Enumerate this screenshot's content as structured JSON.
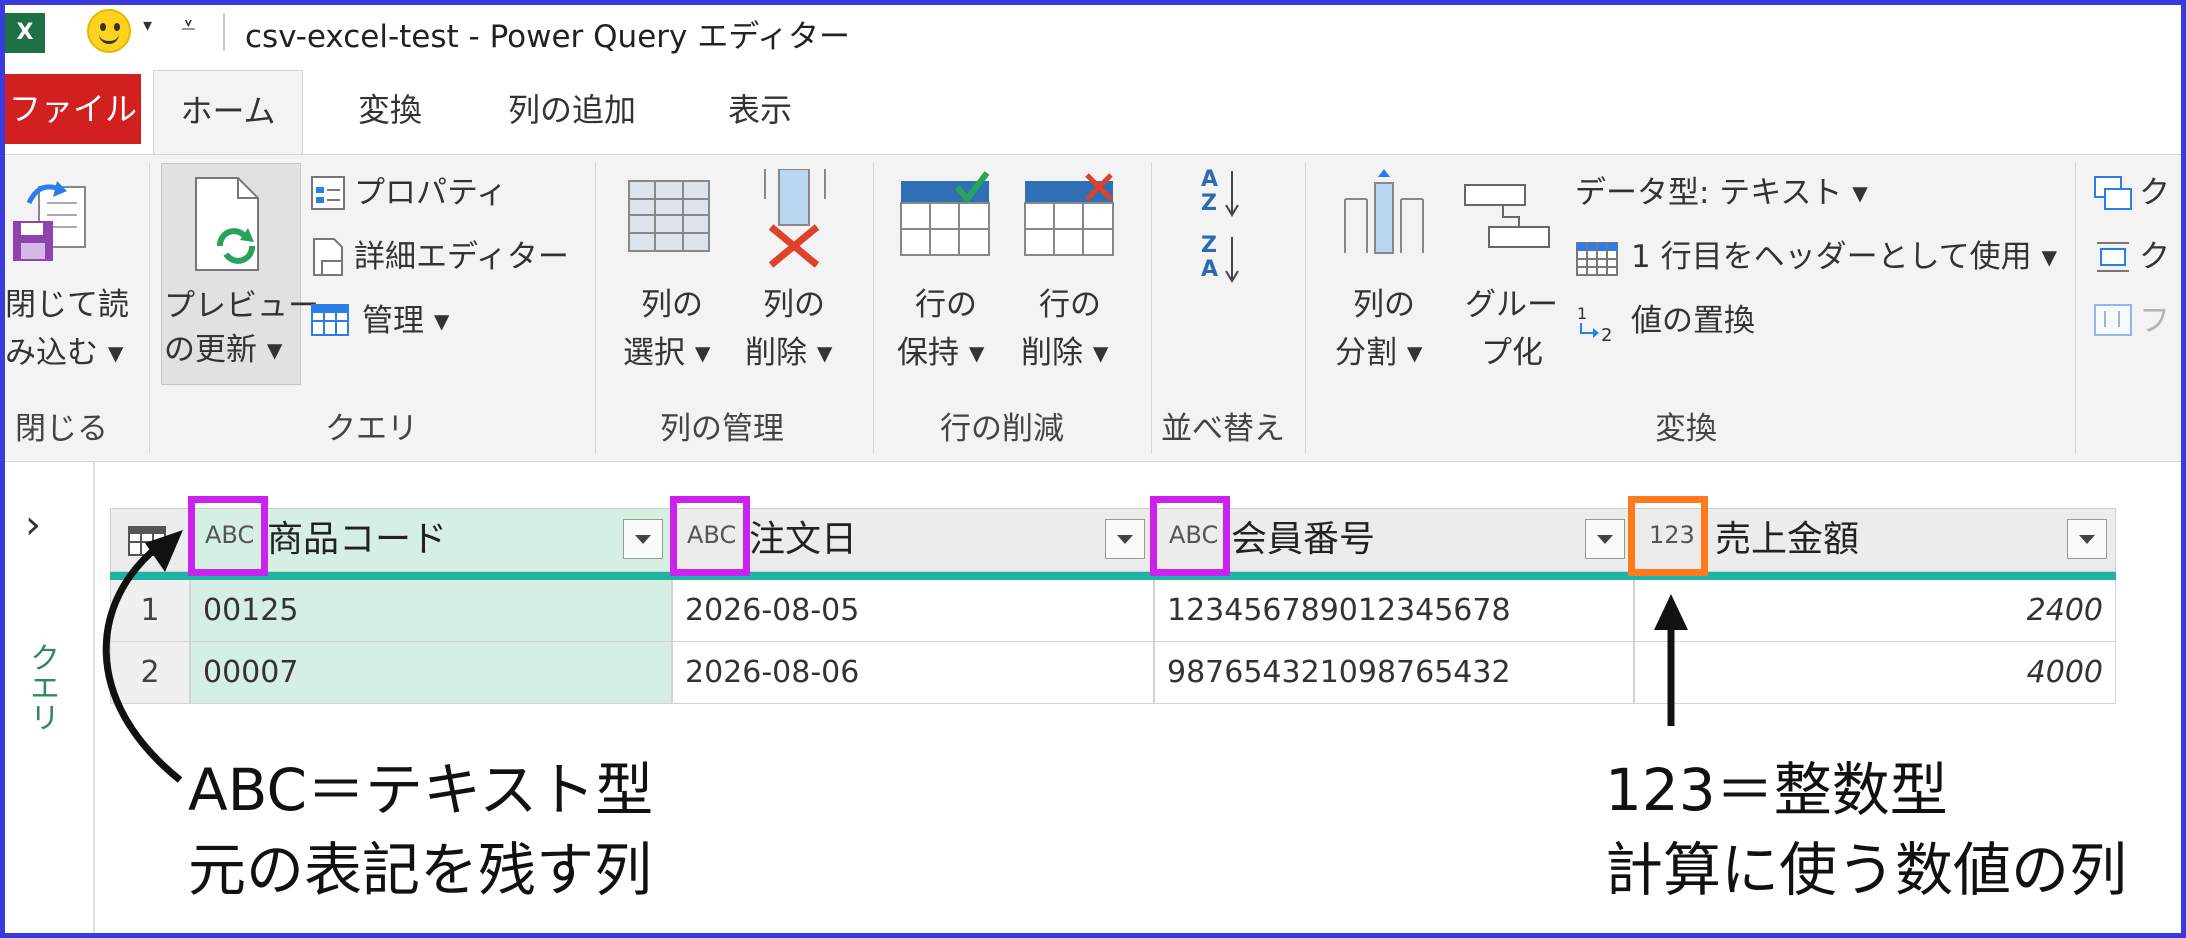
{
  "titlebar": {
    "excel_logo": "X",
    "window_title": "csv-excel-test - Power Query エディター",
    "qa_dropdown": "▾",
    "qa_customize": "⩡"
  },
  "tabs": [
    {
      "label": "ファイル"
    },
    {
      "label": "ホーム"
    },
    {
      "label": "変換"
    },
    {
      "label": "列の追加"
    },
    {
      "label": "表示"
    }
  ],
  "ribbon": {
    "close_load": {
      "line1": "閉じて読",
      "line2": "み込む ▾",
      "group": "閉じる"
    },
    "query": {
      "refresh_line1": "プレビュー",
      "refresh_line2": "の更新 ▾",
      "properties": "プロパティ",
      "advanced_editor": "詳細エディター",
      "manage": "管理 ▾",
      "group": "クエリ"
    },
    "manage_columns": {
      "choose_line1": "列の",
      "choose_line2": "選択 ▾",
      "remove_line1": "列の",
      "remove_line2": "削除 ▾",
      "group": "列の管理"
    },
    "reduce_rows": {
      "keep_line1": "行の",
      "keep_line2": "保持 ▾",
      "remove_line1": "行の",
      "remove_line2": "削除 ▾",
      "group": "行の削減"
    },
    "sort": {
      "asc_top": "A",
      "asc_bottom": "Z",
      "desc_top": "Z",
      "desc_bottom": "A",
      "group": "並べ替え"
    },
    "transform": {
      "split_line1": "列の",
      "split_line2": "分割 ▾",
      "group_line1": "グルー",
      "group_line2": "プ化",
      "data_type": "データ型: テキスト ▾",
      "first_row_header": "1 行目をヘッダーとして使用 ▾",
      "replace_values": "値の置換",
      "group": "変換"
    },
    "overflow": {
      "item1": "ク",
      "item2": "ク",
      "item3": "フ"
    }
  },
  "left_pane": {
    "expand": "›",
    "label": "クエリ"
  },
  "table": {
    "columns": [
      {
        "name": "商品コード",
        "type_icon": "ABC"
      },
      {
        "name": "注文日",
        "type_icon": "ABC"
      },
      {
        "name": "会員番号",
        "type_icon": "ABC"
      },
      {
        "name": "売上金額",
        "type_icon": "123"
      }
    ],
    "rows": [
      {
        "num": "1",
        "cells": [
          "00125",
          "2026-08-05",
          "123456789012345678",
          "2400"
        ]
      },
      {
        "num": "2",
        "cells": [
          "00007",
          "2026-08-06",
          "987654321098765432",
          "4000"
        ]
      }
    ]
  },
  "annotations": {
    "left_line1": "ABC＝テキスト型",
    "left_line2": "元の表記を残す列",
    "right_line1": "123＝整数型",
    "right_line2": "計算に使う数値の列"
  },
  "colors": {
    "frame": "#3b3bdd",
    "file_tab": "#d21f1f",
    "text_type_highlight": "#cc22ee",
    "number_type_highlight": "#ff7a1a",
    "quality_bar": "#1db3a5",
    "selected_column": "#d5efe3"
  }
}
